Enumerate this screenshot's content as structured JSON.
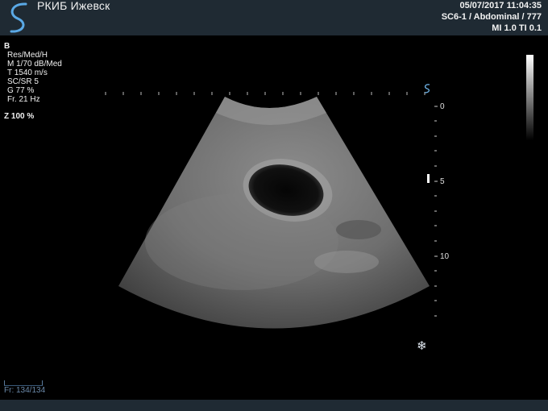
{
  "header": {
    "title": "РКИБ Ижевск",
    "datetime": "05/07/2017 11:04:35",
    "probe_preset": "SC6-1 / Abdominal / 777",
    "indices": "MI 1.0  TI 0.1"
  },
  "params": {
    "mode": "B",
    "lines": [
      "Res/Med/H",
      "M 1/70 dB/Med",
      "T 1540 m/s",
      "SC/SR 5",
      "G 77 %",
      "Fr. 21 Hz"
    ],
    "zoom": "Z  100  %"
  },
  "depth_scale": {
    "labels": [
      "0",
      "5",
      "10"
    ]
  },
  "cine": {
    "frame": "Fr: 134/134"
  },
  "icons": [
    "logo-icon",
    "orientation-marker-icon",
    "freeze-icon"
  ],
  "colors": {
    "header_bg": "#1f2a33",
    "logo": "#5aa9e6",
    "accent": "#6fb4e8"
  }
}
